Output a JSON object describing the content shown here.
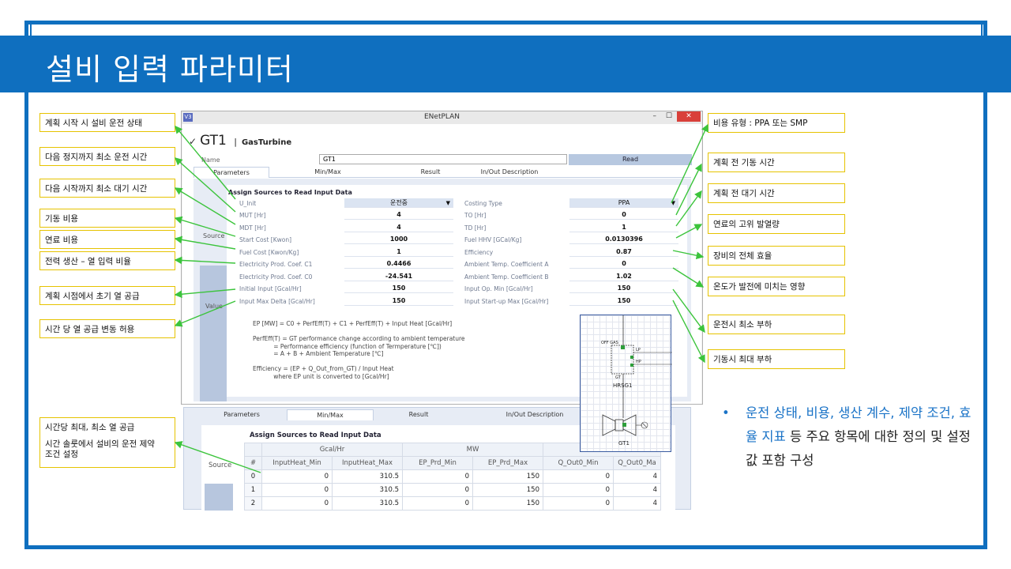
{
  "slide_title": "설비 입력 파라미터",
  "left_callouts": [
    "계획 시작 시 설비 운전 상태",
    "다음 정지까지 최소 운전 시간",
    "다음 시작까지 최소 대기 시간",
    "기동 비용",
    "연료 비용",
    "전력 생산 – 열 입력 비율",
    "계획 시점에서 초기 열 공급",
    "시간 당 열 공급 변동 허용"
  ],
  "left_callout_bottom": {
    "line1": "시간당 최대, 최소 열 공급",
    "line2": "시간 솔룻에서 설비의 운전 제약",
    "line3": "조건 설정"
  },
  "right_callouts": [
    "비용 유형 : PPA 또는 SMP",
    "계획 전 기동 시간",
    "계획 전 대기 시간",
    "연료의 고위 발열량",
    "장비의 전체 효율",
    "온도가 발전에 미치는 영향",
    "운전시 최소 부하",
    "기동시 최대 부하"
  ],
  "window": {
    "app_title": "ENetPLAN",
    "app_icon": "V3",
    "minimize": "–",
    "maximize": "☐",
    "close": "✕",
    "unit_name": "GT1",
    "unit_type": "GasTurbine",
    "name_label": "Name",
    "name_value": "GT1",
    "read_button": "Read",
    "tabs": [
      "Parameters",
      "Min/Max",
      "Result",
      "In/Out Description"
    ],
    "side_source": "Source",
    "side_value": "Value",
    "section_title": "Assign Sources to Read Input Data",
    "left_params": [
      {
        "label": "U_Init",
        "value": "운전중"
      },
      {
        "label": "MUT [Hr]",
        "value": "4"
      },
      {
        "label": "MDT [Hr]",
        "value": "4"
      },
      {
        "label": "Start Cost [Kwon]",
        "value": "1000"
      },
      {
        "label": "Fuel Cost [Kwon/Kg]",
        "value": "1"
      },
      {
        "label": "Electricity Prod. Coef. C1",
        "value": "0.4466"
      },
      {
        "label": "Electricity Prod. Coef. C0",
        "value": "-24.541"
      },
      {
        "label": "Initial Input [Gcal/Hr]",
        "value": "150"
      },
      {
        "label": "Input Max Delta [Gcal/Hr]",
        "value": "150"
      }
    ],
    "right_params": [
      {
        "label": "Costing Type",
        "value": "PPA"
      },
      {
        "label": "TO [Hr]",
        "value": "0"
      },
      {
        "label": "TD [Hr]",
        "value": "1"
      },
      {
        "label": "Fuel HHV [GCal/Kg]",
        "value": "0.0130396"
      },
      {
        "label": "Efficiency",
        "value": "0.87"
      },
      {
        "label": "Ambient Temp. Coefficient A",
        "value": "0"
      },
      {
        "label": "Ambient Temp. Coefficient B",
        "value": "1.02"
      },
      {
        "label": "Input Op. Min [Gcal/Hr]",
        "value": "150"
      },
      {
        "label": "Input Start-up Max [Gcal/Hr]",
        "value": "150"
      }
    ],
    "formula_text": "EP [MW] = C0 + PerfEff(T) + C1 + PerfEff(T) + Input Heat [Gcal/Hr]\n\nPerfEff(T) = GT performance change according to ambient temperature\n           = Performance efficiency (function of Termperature [℃])\n           = A + B + Ambient Temperature [℃]\n\nEfficiency = (EP + Q_Out_from_GT) / Input Heat\n           where EP unit is converted to [Gcal/Hr]"
  },
  "window2": {
    "tabs": [
      "Parameters",
      "Min/Max",
      "Result",
      "In/Out Description"
    ],
    "section_title": "Assign Sources to Read Input Data",
    "side_source": "Source",
    "group_headers": [
      "Gcal/Hr",
      "MW"
    ],
    "columns": [
      "#",
      "InputHeat_Min",
      "InputHeat_Max",
      "EP_Prd_Min",
      "EP_Prd_Max",
      "Q_Out0_Min",
      "Q_Out0_Ma"
    ],
    "rows": [
      [
        "0",
        "0",
        "310.5",
        "0",
        "150",
        "0",
        "4"
      ],
      [
        "1",
        "0",
        "310.5",
        "0",
        "150",
        "0",
        "4"
      ],
      [
        "2",
        "0",
        "310.5",
        "0",
        "150",
        "0",
        "4"
      ]
    ]
  },
  "diagram": {
    "off_gas": "OFF GAS",
    "lp": "LP",
    "hp": "HP",
    "gt_top": "GT",
    "hrsg": "HRSG1",
    "gt_bottom": "GT1"
  },
  "bullet": {
    "highlight1": "운전 상태, 비용, 생산 계수, 제약 조건,",
    "highlight2": "효율 지표",
    "rest": " 등 주요 항목에 대한 정의 및 설정값 포함 구성"
  },
  "colors": {
    "brand_blue": "#0f6fbf",
    "arrow_green": "#3cc43c",
    "callout_border": "#e6c300"
  }
}
